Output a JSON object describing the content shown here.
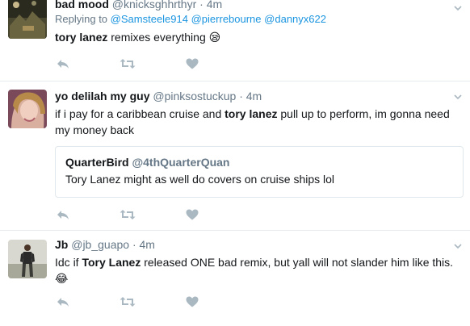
{
  "colors": {
    "link": "#1b95e0",
    "muted": "#657786",
    "icon": "#aab8c2",
    "divider": "#e6ecf0"
  },
  "tweets": [
    {
      "name": "bad mood",
      "handle": "@knicksghhrthyr",
      "dot": "·",
      "time": "4m",
      "reply_prefix": "Replying to",
      "reply_mentions": [
        "@Samsteele914",
        "@pierrebourne",
        "@dannyx622"
      ],
      "text_bold": "tory lanez",
      "text_rest": " remixes everything ",
      "emoji": "😪"
    },
    {
      "name": "yo delilah my guy",
      "handle": "@pinksostuckup",
      "dot": "·",
      "time": "4m",
      "text_pre": "if i pay for a caribbean cruise and ",
      "text_bold": "tory lanez",
      "text_post": " pull up to perform, im gonna need my money back",
      "quote": {
        "name": "QuarterBird",
        "handle": "@4thQuarterQuan",
        "text": "Tory Lanez might as well do covers on cruise ships lol"
      }
    },
    {
      "name": "Jb",
      "handle": "@jb_guapo",
      "dot": "·",
      "time": "4m",
      "text_pre": "Idc if ",
      "text_bold": "Tory Lanez",
      "text_post": " released ONE bad remix, but yall will not slander him like this.",
      "emoji": "😂"
    }
  ],
  "icons": {
    "reply": "reply-icon",
    "retweet": "retweet-icon",
    "like": "heart-icon",
    "more": "chevron-down-icon"
  }
}
